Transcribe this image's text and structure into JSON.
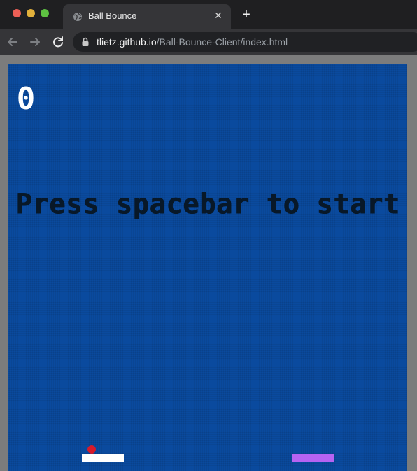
{
  "browser": {
    "tab": {
      "title": "Ball Bounce",
      "close_glyph": "✕",
      "favicon": "globe-icon"
    },
    "new_tab_glyph": "+",
    "address_bar": {
      "host": "tlietz.github.io",
      "path": "/Ball-Bounce-Client/index.html"
    },
    "nav": {
      "back_icon": "arrow-left-icon",
      "forward_icon": "arrow-right-icon",
      "reload_icon": "reload-icon"
    },
    "colors": {
      "traffic_red": "#ec5f56",
      "traffic_yellow": "#e3b13b",
      "traffic_green": "#5ec242"
    }
  },
  "game": {
    "score": "0",
    "message": "Press spacebar to start",
    "colors": {
      "background": "#0a4a9e",
      "ball": "#d81a2a",
      "left_paddle": "#ffffff",
      "right_paddle": "#b663f2"
    }
  }
}
